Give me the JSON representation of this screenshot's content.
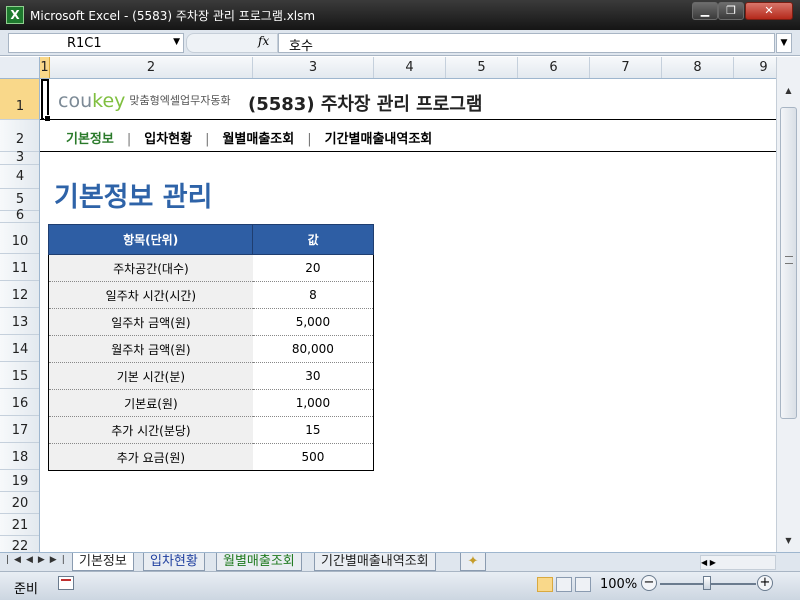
{
  "window": {
    "title": "Microsoft Excel - (5583) 주차장 관리 프로그램.xlsm",
    "app_icon": "X"
  },
  "formula_bar": {
    "name_box": "R1C1",
    "fx": "fx",
    "formula": "호수"
  },
  "grid": {
    "columns": [
      "1",
      "2",
      "3",
      "4",
      "5",
      "6",
      "7",
      "8",
      "9"
    ],
    "rows": [
      "1",
      "2",
      "3",
      "4",
      "5",
      "6",
      "10",
      "11",
      "12",
      "13",
      "14",
      "15",
      "16",
      "17",
      "18",
      "19",
      "20",
      "21",
      "22"
    ]
  },
  "header": {
    "logo_part1": "cou",
    "logo_part2": "key",
    "logo_tagline": "맞춤형엑셀업무자동화",
    "app_title": "(5583) 주차장 관리 프로그램"
  },
  "nav": {
    "items": [
      "기본정보",
      "입차현황",
      "월별매출조회",
      "기간별매출내역조회"
    ],
    "separator": "|",
    "active_color": "#2a7a2a"
  },
  "section": {
    "title": "기본정보 관리",
    "title_color": "#2e63a8"
  },
  "params_table": {
    "header_color": "#2e5ea4",
    "columns": [
      "항목(단위)",
      "값"
    ],
    "rows": [
      {
        "label": "주차공간(대수)",
        "value": "20"
      },
      {
        "label": "일주차 시간(시간)",
        "value": "8"
      },
      {
        "label": "일주차 금액(원)",
        "value": "5,000"
      },
      {
        "label": "월주차 금액(원)",
        "value": "80,000"
      },
      {
        "label": "기본 시간(분)",
        "value": "30"
      },
      {
        "label": "기본료(원)",
        "value": "1,000"
      },
      {
        "label": "추가 시간(분당)",
        "value": "15"
      },
      {
        "label": "추가 요금(원)",
        "value": "500"
      }
    ]
  },
  "sheet_tabs": {
    "tabs": [
      "기본정보",
      "입차현황",
      "월별매출조회",
      "기간별매출내역조회"
    ],
    "active": "기본정보"
  },
  "statusbar": {
    "status": "준비",
    "zoom": "100%"
  }
}
